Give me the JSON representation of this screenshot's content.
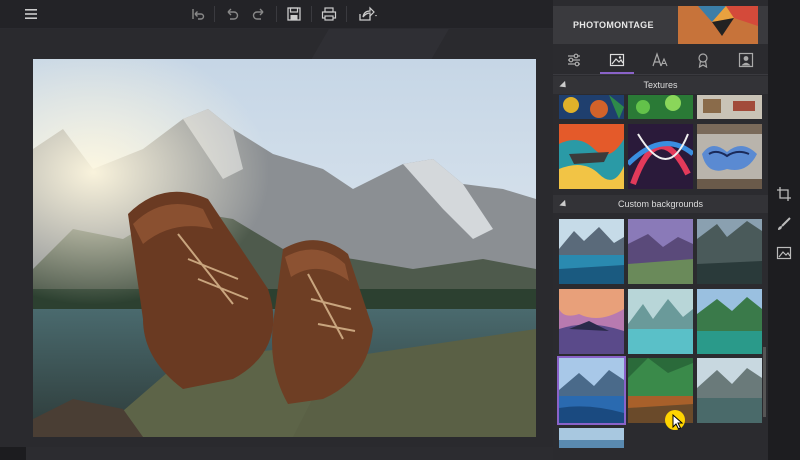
{
  "app": {
    "brand": "PHOTOMONTAGE",
    "accent_color": "#8a63c9"
  },
  "toolbar": {
    "buttons": [
      {
        "name": "menu-icon"
      },
      {
        "name": "undo-all-icon"
      },
      {
        "name": "undo-icon"
      },
      {
        "name": "redo-icon"
      },
      {
        "name": "save-icon"
      },
      {
        "name": "print-icon"
      },
      {
        "name": "share-icon"
      }
    ]
  },
  "panel": {
    "tabs": [
      {
        "name": "adjust-icon",
        "active": false
      },
      {
        "name": "image-icon",
        "active": true
      },
      {
        "name": "text-icon",
        "active": false
      },
      {
        "name": "badge-icon",
        "active": false
      },
      {
        "name": "person-icon",
        "active": false
      }
    ],
    "textures_label": "Textures",
    "custom_backgrounds_label": "Custom backgrounds"
  },
  "tools": [
    {
      "name": "crop-icon"
    },
    {
      "name": "brush-icon"
    },
    {
      "name": "picture-icon"
    }
  ],
  "canvas": {
    "cross_marker": "×"
  }
}
